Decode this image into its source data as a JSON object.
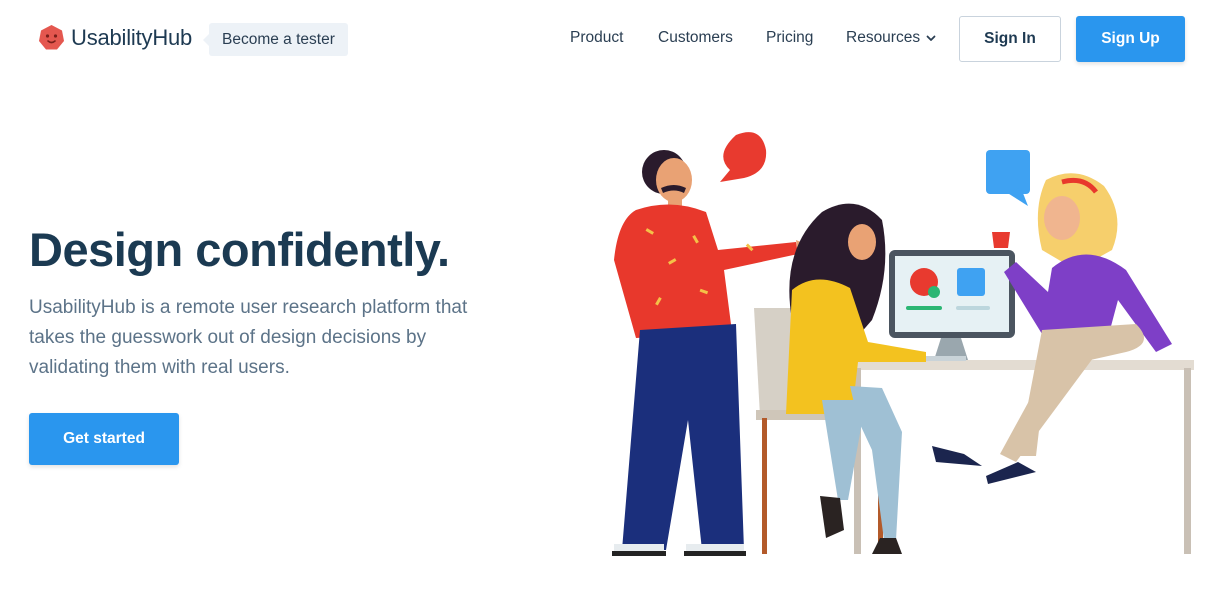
{
  "header": {
    "logo_text": "UsabilityHub",
    "tester_label": "Become a tester",
    "nav": [
      "Product",
      "Customers",
      "Pricing",
      "Resources"
    ],
    "signin_label": "Sign In",
    "signup_label": "Sign Up"
  },
  "hero": {
    "title": "Design confidently.",
    "subtitle": "UsabilityHub is a remote user research platform that takes the guesswork out of design decisions by validating them with real users.",
    "cta_label": "Get started"
  },
  "colors": {
    "primary": "#2a96ee",
    "heading": "#1b3a52",
    "body_text": "#5c7388",
    "logo_red": "#e4574f"
  },
  "icons": [
    "logo-mark-icon",
    "chevron-down-icon"
  ]
}
